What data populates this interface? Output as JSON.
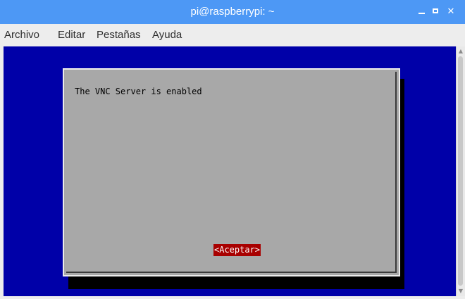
{
  "window": {
    "title": "pi@raspberrypi: ~",
    "titlebar_color": "#4d98f5",
    "controls": {
      "minimize_icon": "minimize-icon",
      "maximize_icon": "maximize-icon",
      "close_icon": "close-icon",
      "close_glyph": "✕"
    }
  },
  "menubar": {
    "items": [
      {
        "label": "Archivo"
      },
      {
        "label": "Editar"
      },
      {
        "label": "Pestañas"
      },
      {
        "label": "Ayuda"
      }
    ]
  },
  "terminal": {
    "background_color": "#0000a8",
    "dialog": {
      "message": "The VNC Server is enabled",
      "button_label": "<Aceptar>",
      "background_color": "#a8a8a8",
      "button_color": "#a80000"
    }
  },
  "scrollbar": {
    "up_icon": "scroll-up-arrow-icon",
    "down_icon": "scroll-down-arrow-icon",
    "up_glyph": "▲",
    "down_glyph": "▼"
  }
}
